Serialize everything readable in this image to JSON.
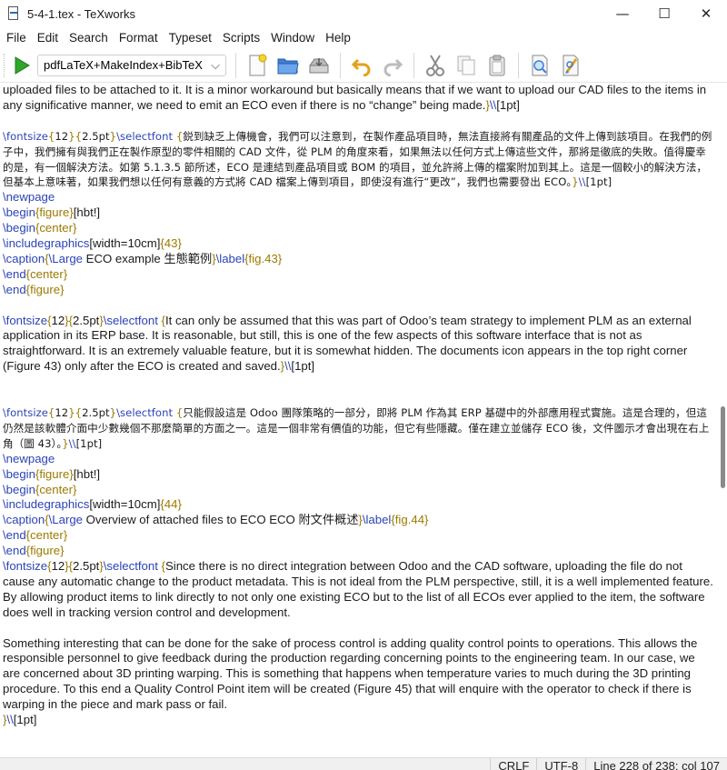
{
  "window": {
    "title": "5-4-1.tex - TeXworks",
    "minimize": "—",
    "maximize": "☐",
    "close": "✕"
  },
  "menu": [
    "File",
    "Edit",
    "Search",
    "Format",
    "Typeset",
    "Scripts",
    "Window",
    "Help"
  ],
  "toolbar": {
    "engine": "pdfLaTeX+MakeIndex+BibTeX",
    "icons": [
      "typeset-run-icon",
      "new-file-icon",
      "open-folder-icon",
      "save-icon",
      "undo-icon",
      "redo-icon",
      "cut-icon",
      "copy-icon",
      "paste-icon",
      "find-icon",
      "replace-icon"
    ],
    "colors": {
      "run": "#2fa52a",
      "folder": "#3c7fd6",
      "undo": "#e3a21a"
    }
  },
  "editor": {
    "lines": [
      [
        {
          "t": "uploaded files to be attached to it. It is a minor workaround but basically means that if we want to upload our CAD files to the items in any significative manner, we need to emit an ECO even if there is no “change” being made."
        },
        {
          "t": "}",
          "c": "br"
        },
        {
          "t": "\\\\",
          "c": "cmd"
        },
        {
          "t": "[1pt]"
        }
      ],
      [],
      [
        {
          "t": "\\fontsize",
          "c": "cmd"
        },
        {
          "t": "{",
          "c": "br"
        },
        {
          "t": "12"
        },
        {
          "t": "}{",
          "c": "br"
        },
        {
          "t": "2.5pt"
        },
        {
          "t": "}",
          "c": "br"
        },
        {
          "t": "\\selectfont",
          "c": "cmd"
        },
        {
          "t": " {",
          "c": "br"
        },
        {
          "t": "鋭到缺乏上傳機會，我們可以注意到，在製作產品項目時，無法直接將有關產品的文件上傳到該項目。在我們的例子中，我們擁有與我們正在製作原型的零件相關的 CAD 文件，從 PLM 的角度來看，如果無法以任何方式上傳這些文件，那將是徹底的失敗。值得慶幸的是，有一個解決方法。如第 5.1.3.5 節所述，ECO 是連結到產品項目或 BOM 的項目，並允許將上傳的檔案附加到其上。這是一個較小的解決方法，但基本上意味著，如果我們想以任何有意義的方式將 CAD 檔案上傳到項目，即使沒有進行“更改”，我們也需要發出 ECO。",
          "cjk": true
        },
        {
          "t": "}",
          "c": "br"
        },
        {
          "t": "\\\\",
          "c": "cmd"
        },
        {
          "t": "[1pt]"
        }
      ],
      [
        {
          "t": "\\newpage",
          "c": "cmd"
        }
      ],
      [
        {
          "t": "\\begin",
          "c": "cmd"
        },
        {
          "t": "{figure}",
          "c": "br"
        },
        {
          "t": "[hbt!]"
        }
      ],
      [
        {
          "t": "\\begin",
          "c": "cmd"
        },
        {
          "t": "{center}",
          "c": "br"
        }
      ],
      [
        {
          "t": "\\includegraphics",
          "c": "cmd"
        },
        {
          "t": "[width=10cm]"
        },
        {
          "t": "{43}",
          "c": "br"
        }
      ],
      [
        {
          "t": "\\caption",
          "c": "cmd"
        },
        {
          "t": "{",
          "c": "br"
        },
        {
          "t": "\\Large",
          "c": "cmd"
        },
        {
          "t": " ECO example  生態範例"
        },
        {
          "t": "}",
          "c": "br"
        },
        {
          "t": "\\label",
          "c": "cmd"
        },
        {
          "t": "{fig.43}",
          "c": "br"
        }
      ],
      [
        {
          "t": "\\end",
          "c": "cmd"
        },
        {
          "t": "{center}",
          "c": "br"
        }
      ],
      [
        {
          "t": "\\end",
          "c": "cmd"
        },
        {
          "t": "{figure}",
          "c": "br"
        }
      ],
      [],
      [
        {
          "t": "\\fontsize",
          "c": "cmd"
        },
        {
          "t": "{",
          "c": "br"
        },
        {
          "t": "12"
        },
        {
          "t": "}{",
          "c": "br"
        },
        {
          "t": "2.5pt"
        },
        {
          "t": "}",
          "c": "br"
        },
        {
          "t": "\\selectfont",
          "c": "cmd"
        },
        {
          "t": " {",
          "c": "br"
        },
        {
          "t": "It can only be assumed that this was part of Odoo’s team strategy to implement PLM as an external application in its ERP base. It is reasonable, but still, this is one of the few aspects of this software interface that is not as straightforward. It is an extremely valuable feature, but it is somewhat hidden. The documents icon appears in the top right corner (Figure 43) only after the ECO is created and saved."
        },
        {
          "t": "}",
          "c": "br"
        },
        {
          "t": "\\\\",
          "c": "cmd"
        },
        {
          "t": "[1pt]"
        }
      ],
      [],
      [],
      [
        {
          "t": "\\fontsize",
          "c": "cmd"
        },
        {
          "t": "{",
          "c": "br"
        },
        {
          "t": "12"
        },
        {
          "t": "}{",
          "c": "br"
        },
        {
          "t": "2.5pt"
        },
        {
          "t": "}",
          "c": "br"
        },
        {
          "t": "\\selectfont",
          "c": "cmd"
        },
        {
          "t": " {",
          "c": "br"
        },
        {
          "t": "只能假設這是 Odoo 團隊策略的一部分，即將 PLM 作為其 ERP 基礎中的外部應用程式實施。這是合理的，但這仍然是該軟體介面中少數幾個不那麼簡單的方面之一。這是一個非常有價值的功能，但它有些隱藏。僅在建立並儲存 ECO 後，文件圖示才會出現在右上角（圖 43）。",
          "cjk": true
        },
        {
          "t": "}",
          "c": "br"
        },
        {
          "t": "\\\\",
          "c": "cmd"
        },
        {
          "t": "[1pt]"
        }
      ],
      [
        {
          "t": "\\newpage",
          "c": "cmd"
        }
      ],
      [
        {
          "t": "\\begin",
          "c": "cmd"
        },
        {
          "t": "{figure}",
          "c": "br"
        },
        {
          "t": "[hbt!]"
        }
      ],
      [
        {
          "t": "\\begin",
          "c": "cmd"
        },
        {
          "t": "{center}",
          "c": "br"
        }
      ],
      [
        {
          "t": "\\includegraphics",
          "c": "cmd"
        },
        {
          "t": "[width=10cm]"
        },
        {
          "t": "{44}",
          "c": "br"
        }
      ],
      [
        {
          "t": "\\caption",
          "c": "cmd"
        },
        {
          "t": "{",
          "c": "br"
        },
        {
          "t": "\\Large",
          "c": "cmd"
        },
        {
          "t": " Overview of attached files to ECO ECO 附文件概述"
        },
        {
          "t": "}",
          "c": "br"
        },
        {
          "t": "\\label",
          "c": "cmd"
        },
        {
          "t": "{fig.44}",
          "c": "br"
        }
      ],
      [
        {
          "t": "\\end",
          "c": "cmd"
        },
        {
          "t": "{center}",
          "c": "br"
        }
      ],
      [
        {
          "t": "\\end",
          "c": "cmd"
        },
        {
          "t": "{figure}",
          "c": "br"
        }
      ],
      [
        {
          "t": "\\fontsize",
          "c": "cmd"
        },
        {
          "t": "{",
          "c": "br"
        },
        {
          "t": "12"
        },
        {
          "t": "}{",
          "c": "br"
        },
        {
          "t": "2.5pt"
        },
        {
          "t": "}",
          "c": "br"
        },
        {
          "t": "\\selectfont",
          "c": "cmd"
        },
        {
          "t": " {",
          "c": "br"
        },
        {
          "t": "Since there is no direct integration between Odoo and the CAD software, uploading the file do not cause any automatic change to the product metadata. This is not ideal from the PLM perspective, still, it is a well implemented feature. By allowing product items to link directly to not only one existing ECO but to the list of all ECOs ever applied to the item, the software does well in tracking version control and development."
        }
      ],
      [],
      [
        {
          "t": "Something interesting that can be done for the sake of process control is adding quality control points to operations. This allows the responsible personnel to give feedback during the production regarding concerning points to the engineering team. In our case, we are concerned about 3D printing warping. This is something that happens when temperature varies to much during the 3D printing procedure. To this end a Quality Control Point item will be created (Figure 45) that will enquire with the operator to check if there is warping in the piece and mark pass or fail."
        }
      ],
      [
        {
          "t": "}",
          "c": "br"
        },
        {
          "t": "\\\\",
          "c": "cmd"
        },
        {
          "t": "[1pt]"
        }
      ]
    ]
  },
  "status": {
    "line_ending": "CRLF",
    "encoding": "UTF-8",
    "position": "Line 228 of 238; col 107"
  }
}
